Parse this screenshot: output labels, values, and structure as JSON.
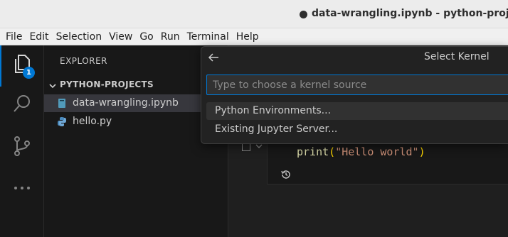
{
  "window": {
    "title": "data-wrangling.ipynb - python-projects"
  },
  "menubar": {
    "items": [
      "File",
      "Edit",
      "Selection",
      "View",
      "Go",
      "Run",
      "Terminal",
      "Help"
    ]
  },
  "activitybar": {
    "explorer_badge": "1",
    "icons": [
      "files-icon",
      "search-icon",
      "source-control-icon",
      "more-icon"
    ]
  },
  "sidebar": {
    "title": "EXPLORER",
    "folder": "PYTHON-PROJECTS",
    "files": [
      {
        "name": "data-wrangling.ipynb",
        "selected": true,
        "icon": "notebook-icon"
      },
      {
        "name": "hello.py",
        "selected": false,
        "icon": "python-icon"
      }
    ]
  },
  "editor": {
    "code": {
      "fn": "print",
      "open": "(",
      "str": "\"Hello world\"",
      "close": ")"
    }
  },
  "quickpick": {
    "title": "Select Kernel",
    "placeholder": "Type to choose a kernel source",
    "items": [
      {
        "label": "Python Environments...",
        "active": true
      },
      {
        "label": "Existing Jupyter Server...",
        "active": false
      }
    ]
  },
  "colors": {
    "accent": "#0078d4",
    "selection": "#37373d",
    "background": "#1f1f1f",
    "sidebar": "#181818"
  }
}
